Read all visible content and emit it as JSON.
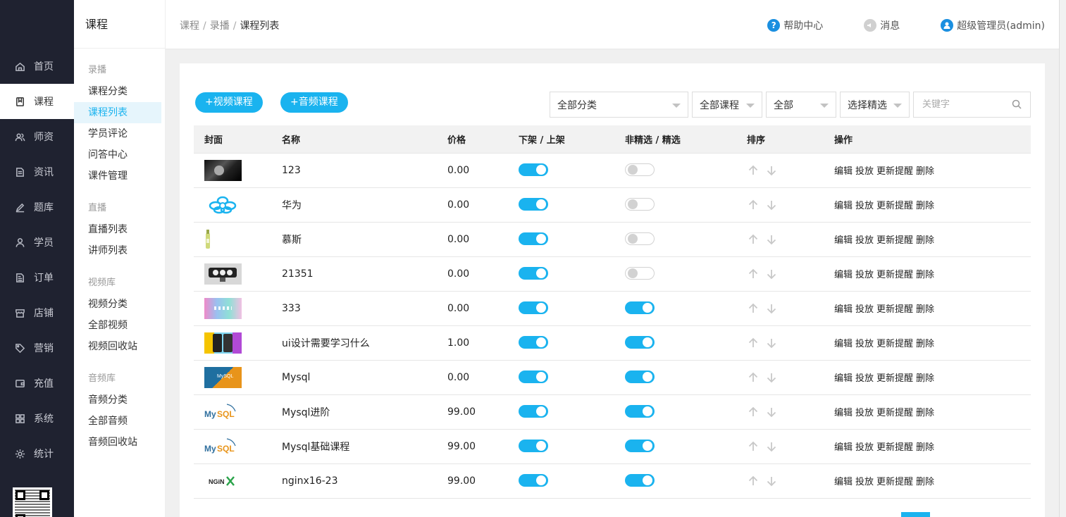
{
  "nav": {
    "items": [
      {
        "label": "首页",
        "icon": "home-icon"
      },
      {
        "label": "课程",
        "icon": "book-icon"
      },
      {
        "label": "师资",
        "icon": "users-icon"
      },
      {
        "label": "资讯",
        "icon": "document-icon"
      },
      {
        "label": "题库",
        "icon": "pencil-icon"
      },
      {
        "label": "学员",
        "icon": "user-icon"
      },
      {
        "label": "订单",
        "icon": "order-icon"
      },
      {
        "label": "店铺",
        "icon": "shop-icon"
      },
      {
        "label": "营销",
        "icon": "tag-icon"
      },
      {
        "label": "充值",
        "icon": "wallet-icon"
      },
      {
        "label": "系统",
        "icon": "grid-icon"
      },
      {
        "label": "统计",
        "icon": "gear-icon"
      }
    ],
    "active_index": 1
  },
  "subnav": {
    "title": "课程",
    "groups": [
      {
        "title": "录播",
        "items": [
          "课程分类",
          "课程列表",
          "学员评论",
          "问答中心",
          "课件管理"
        ]
      },
      {
        "title": "直播",
        "items": [
          "直播列表",
          "讲师列表"
        ]
      },
      {
        "title": "视频库",
        "items": [
          "视频分类",
          "全部视频",
          "视频回收站"
        ]
      },
      {
        "title": "音频库",
        "items": [
          "音频分类",
          "全部音频",
          "音频回收站"
        ]
      }
    ],
    "active_item": "课程列表"
  },
  "topbar": {
    "breadcrumb": [
      "课程",
      "录播",
      "课程列表"
    ],
    "help_label": "帮助中心",
    "message_label": "消息",
    "user_label": "超级管理员(admin)"
  },
  "toolbar": {
    "add_video_label": "+视频课程",
    "add_audio_label": "+音频课程",
    "filters": [
      "全部分类",
      "全部课程",
      "全部",
      "选择精选"
    ],
    "search_placeholder": "关键字"
  },
  "table": {
    "headers": [
      "封面",
      "名称",
      "价格",
      "下架 / 上架",
      "非精选 / 精选",
      "排序",
      "操作"
    ],
    "actions": [
      "编辑",
      "投放",
      "更新提醒",
      "删除"
    ],
    "rows": [
      {
        "name": "123",
        "price": "0.00",
        "on_shelf": true,
        "featured": false,
        "thumb": "dark-photo"
      },
      {
        "name": "华为",
        "price": "0.00",
        "on_shelf": true,
        "featured": false,
        "thumb": "huawei-logo"
      },
      {
        "name": "慕斯",
        "price": "0.00",
        "on_shelf": true,
        "featured": false,
        "thumb": "bottle"
      },
      {
        "name": "21351",
        "price": "0.00",
        "on_shelf": true,
        "featured": false,
        "thumb": "device"
      },
      {
        "name": "333",
        "price": "0.00",
        "on_shelf": true,
        "featured": true,
        "thumb": "gradient"
      },
      {
        "name": "ui设计需要学习什么",
        "price": "1.00",
        "on_shelf": true,
        "featured": true,
        "thumb": "phones"
      },
      {
        "name": "Mysql",
        "price": "0.00",
        "on_shelf": true,
        "featured": true,
        "thumb": "mysql-banner"
      },
      {
        "name": "Mysql进阶",
        "price": "99.00",
        "on_shelf": true,
        "featured": true,
        "thumb": "mysql-logo"
      },
      {
        "name": "Mysql基础课程",
        "price": "99.00",
        "on_shelf": true,
        "featured": true,
        "thumb": "mysql-logo"
      },
      {
        "name": "nginx16-23",
        "price": "99.00",
        "on_shelf": true,
        "featured": true,
        "thumb": "nginx-logo"
      }
    ]
  },
  "colors": {
    "accent": "#1ab3ef",
    "nav_bg": "#1f2230"
  }
}
